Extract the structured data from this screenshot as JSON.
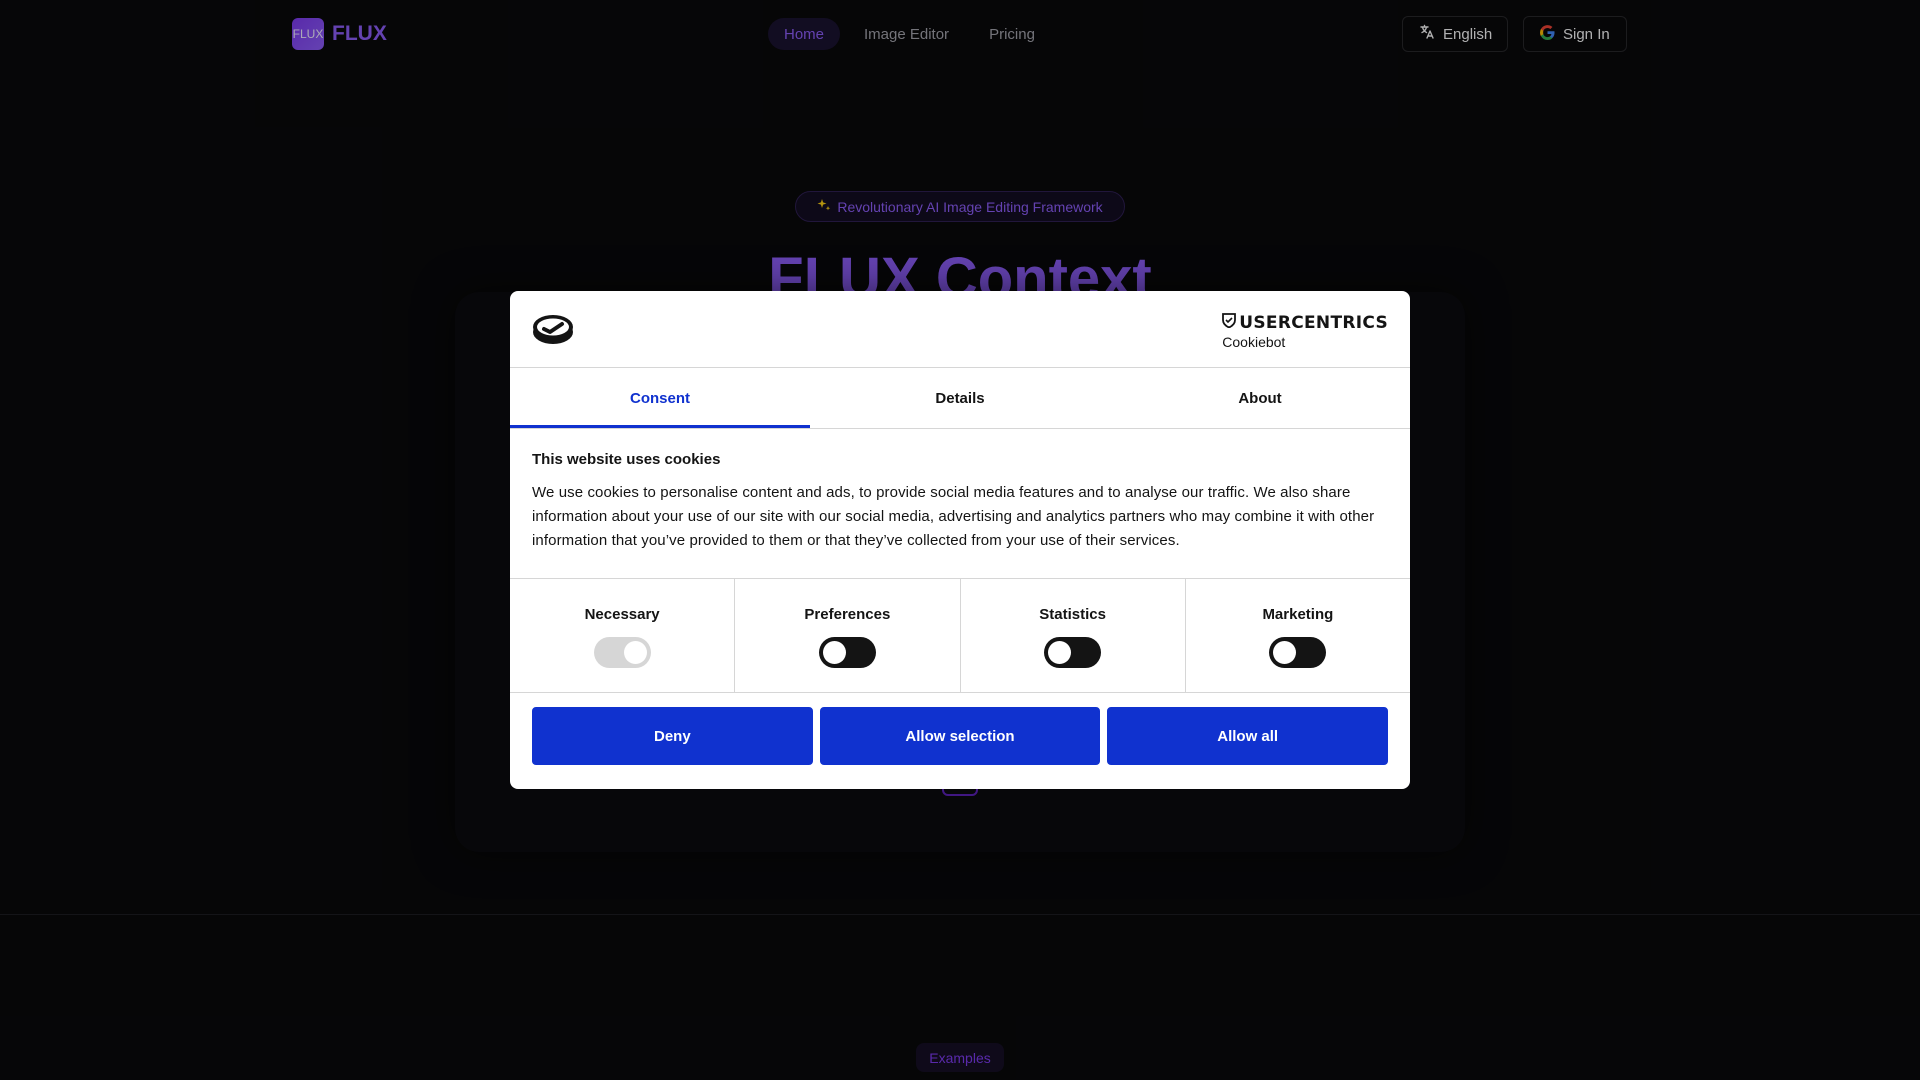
{
  "header": {
    "logo_badge": "FLUX",
    "logo_text": "FLUX",
    "nav": [
      {
        "label": "Home",
        "active": true
      },
      {
        "label": "Image Editor",
        "active": false
      },
      {
        "label": "Pricing",
        "active": false
      }
    ],
    "language_label": "English",
    "language_icon": "translate-icon",
    "signin_label": "Sign In",
    "signin_icon": "google-icon"
  },
  "hero": {
    "pill_label": "Revolutionary AI Image Editing Framework",
    "pill_icon": "sparkle-icon",
    "title": "FLUX Context"
  },
  "examples_label": "Examples",
  "cookie_dialog": {
    "brand_line1": "USERCENTRICS",
    "brand_line2": "Cookiebot",
    "tabs": [
      {
        "label": "Consent",
        "active": true
      },
      {
        "label": "Details",
        "active": false
      },
      {
        "label": "About",
        "active": false
      }
    ],
    "title": "This website uses cookies",
    "text": "We use cookies to personalise content and ads, to provide social media features and to analyse our traffic. We also share information about your use of our site with our social media, advertising and analytics partners who may combine it with other information that you’ve provided to them or that they’ve collected from your use of their services.",
    "toggles": [
      {
        "label": "Necessary",
        "checked": true,
        "disabled": true
      },
      {
        "label": "Preferences",
        "checked": false,
        "disabled": false
      },
      {
        "label": "Statistics",
        "checked": false,
        "disabled": false
      },
      {
        "label": "Marketing",
        "checked": false,
        "disabled": false
      }
    ],
    "buttons": {
      "deny": "Deny",
      "allow_selection": "Allow selection",
      "allow_all": "Allow all"
    }
  },
  "colors": {
    "accent": "#8b5cf6",
    "dialog_button": "#1032cf",
    "background": "#09090b"
  }
}
